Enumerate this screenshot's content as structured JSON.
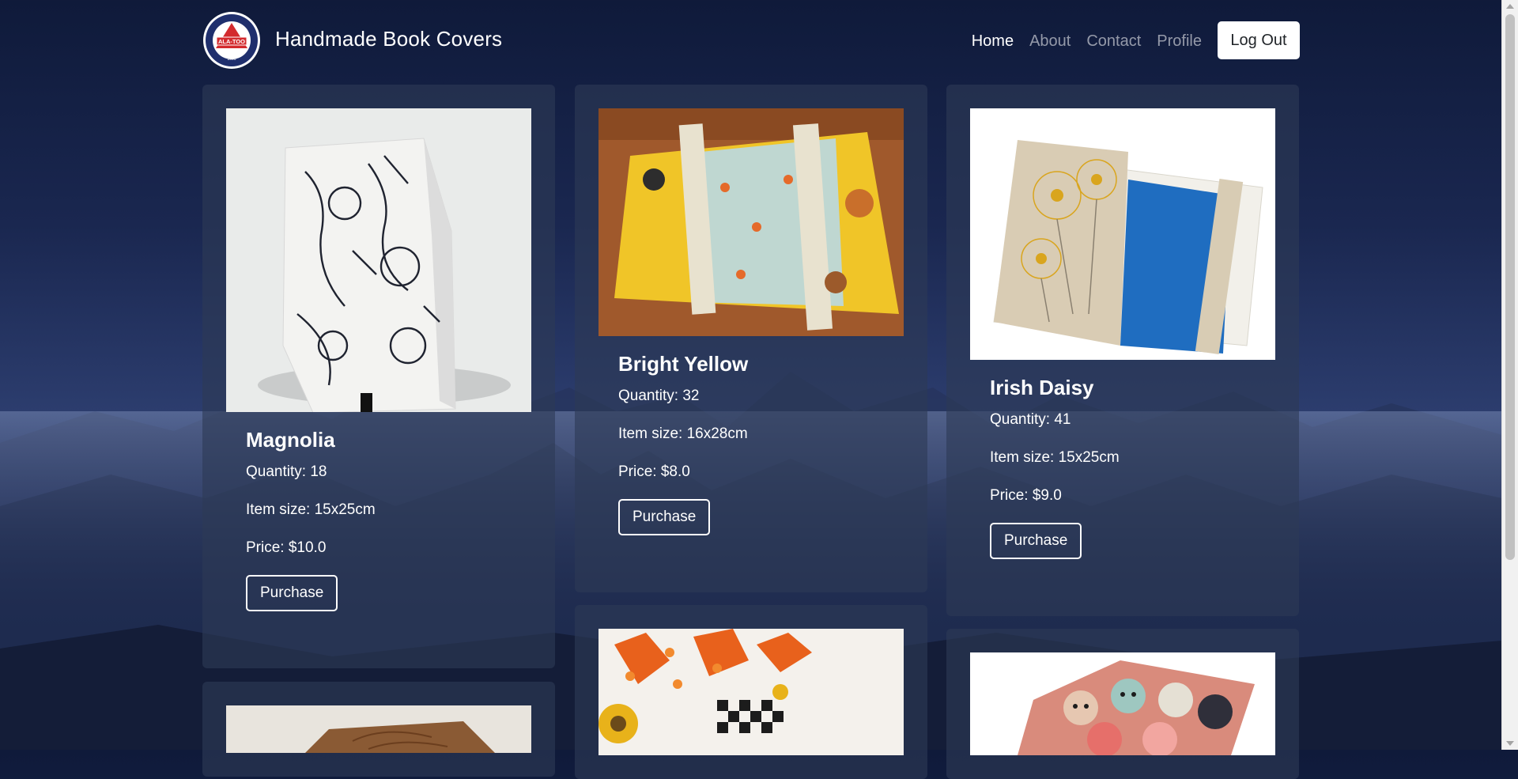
{
  "brand": {
    "title": "Handmade Book Covers",
    "logo_text": "ALA-TOO",
    "logo_year": "1996"
  },
  "nav": {
    "links": [
      {
        "label": "Home",
        "active": true
      },
      {
        "label": "About",
        "active": false
      },
      {
        "label": "Contact",
        "active": false
      },
      {
        "label": "Profile",
        "active": false
      }
    ],
    "logout_label": "Log Out"
  },
  "products": [
    {
      "name": "Magnolia",
      "quantity": "Quantity: 18",
      "size": "Item size: 15x25cm",
      "price": "Price: $10.0",
      "button": "Purchase",
      "image": "magnolia-cover-photo"
    },
    {
      "name": "Bright Yellow",
      "quantity": "Quantity: 32",
      "size": "Item size: 16x28cm",
      "price": "Price: $8.0",
      "button": "Purchase",
      "image": "bright-yellow-cover-photo"
    },
    {
      "name": "Irish Daisy",
      "quantity": "Quantity: 41",
      "size": "Item size: 15x25cm",
      "price": "Price: $9.0",
      "button": "Purchase",
      "image": "irish-daisy-cover-photo"
    }
  ],
  "partial_cards": [
    {
      "image": "leather-cover-photo"
    },
    {
      "image": "autumn-leaves-cover-photo"
    },
    {
      "image": "cats-cover-photo"
    }
  ],
  "colors": {
    "background": "#1a2750",
    "card": "#2d3a55",
    "text": "#ffffff",
    "logo_red": "#d32a2e"
  }
}
